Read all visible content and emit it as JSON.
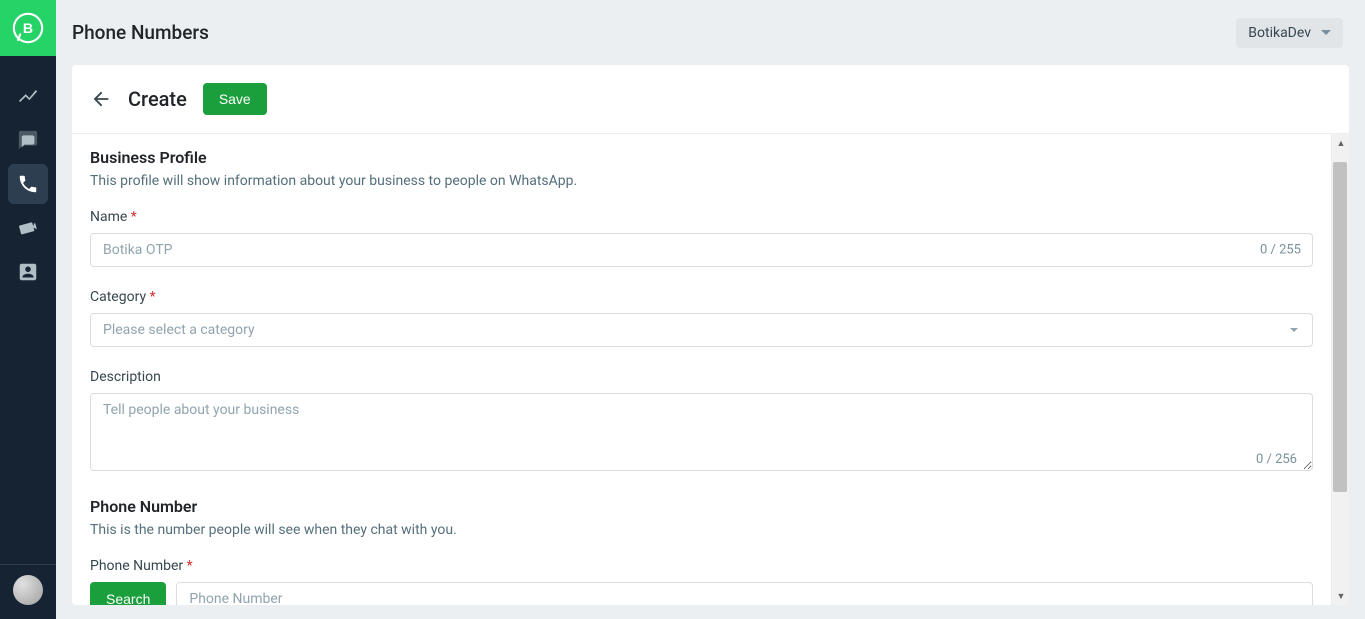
{
  "header": {
    "title": "Phone Numbers",
    "user": "BotikaDev"
  },
  "card": {
    "title": "Create",
    "save_label": "Save"
  },
  "sections": {
    "business_profile": {
      "title": "Business Profile",
      "subtitle": "This profile will show information about your business to people on WhatsApp.",
      "name": {
        "label": "Name",
        "placeholder": "Botika OTP",
        "count": "0 / 255"
      },
      "category": {
        "label": "Category",
        "placeholder": "Please select a category"
      },
      "description": {
        "label": "Description",
        "placeholder": "Tell people about your business",
        "count": "0 / 256"
      }
    },
    "phone_number": {
      "title": "Phone Number",
      "subtitle": "This is the number people will see when they chat with you.",
      "label": "Phone Number",
      "search_label": "Search",
      "placeholder": "Phone Number"
    }
  },
  "required_marker": "*"
}
